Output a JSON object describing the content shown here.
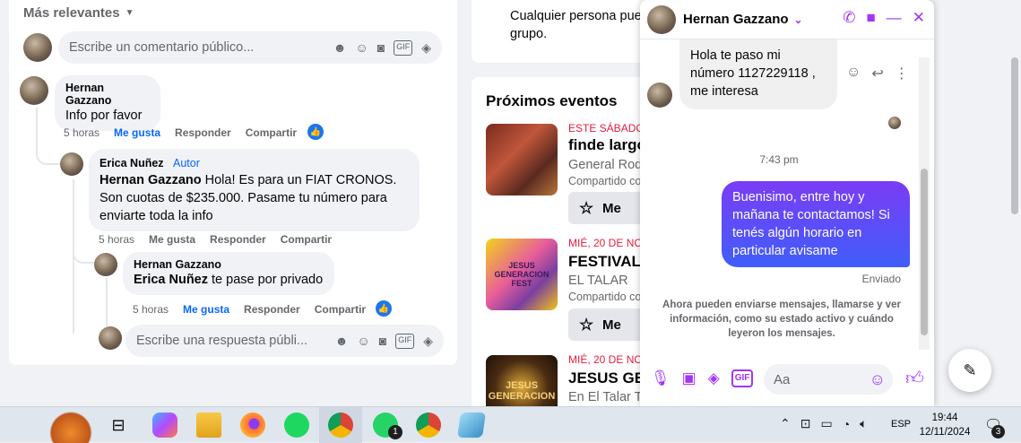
{
  "comments": {
    "sort_label": "Más relevantes",
    "input_placeholder": "Escribe un comentario público...",
    "reply_placeholder": "Escribe una respuesta públi...",
    "c1": {
      "name": "Hernan Gazzano",
      "text": "Info por favor",
      "time": "5 horas",
      "like": "Me gusta",
      "reply": "Responder",
      "share": "Compartir"
    },
    "c2": {
      "name": "Erica Nuñez",
      "badge": "Autor",
      "mention": "Hernan Gazzano",
      "text": " Hola! Es para un FIAT CRONOS. Son cuotas de $235.000. Pasame tu número para enviarte toda la info",
      "time": "5 horas",
      "like": "Me gusta",
      "reply": "Responder",
      "share": "Compartir"
    },
    "c3": {
      "name": "Hernan Gazzano",
      "mention": "Erica Nuñez",
      "text": " te pase por privado",
      "time": "5 horas",
      "like": "Me gusta",
      "reply": "Responder",
      "share": "Compartir"
    }
  },
  "group_card": {
    "line1": "Cualquier persona pue",
    "line2": "grupo."
  },
  "events": {
    "heading": "Próximos eventos",
    "items": [
      {
        "date": "ESTE SÁBADO",
        "title": "finde largo",
        "loc": "General Rod",
        "shared": "Compartido co",
        "btn": "Me"
      },
      {
        "date": "MIÉ, 20 DE NO",
        "title": "FESTIVAL D",
        "loc": "EL TALAR",
        "shared": "Compartido co",
        "btn": "Me"
      },
      {
        "date": "MIÉ, 20 DE NO",
        "title": "JESUS GEN",
        "loc": "En El Talar Ti",
        "shared": "",
        "btn": ""
      }
    ],
    "thumb2_text": "JESUS GENERACION FEST",
    "thumb3_text": "JESUS GENERACION"
  },
  "chat": {
    "contact": "Hernan Gazzano",
    "incoming": "Hola te paso mi número 1127229118 , me interesa",
    "time": "7:43 pm",
    "outgoing": "Buenisimo, entre hoy y mañana te contactamos! Si tenés algún horario en particular avisame",
    "status": "Enviado",
    "notice": "Ahora pueden enviarse mensajes, llamarse y ver información, como su estado activo y cuándo leyeron los mensajes.",
    "input_placeholder": "Aa",
    "accent": "#a334fa"
  },
  "taskbar": {
    "lang": "ESP",
    "time": "19:44",
    "date": "12/11/2024",
    "whatsapp_badge": "1",
    "notif_badge": "3"
  }
}
